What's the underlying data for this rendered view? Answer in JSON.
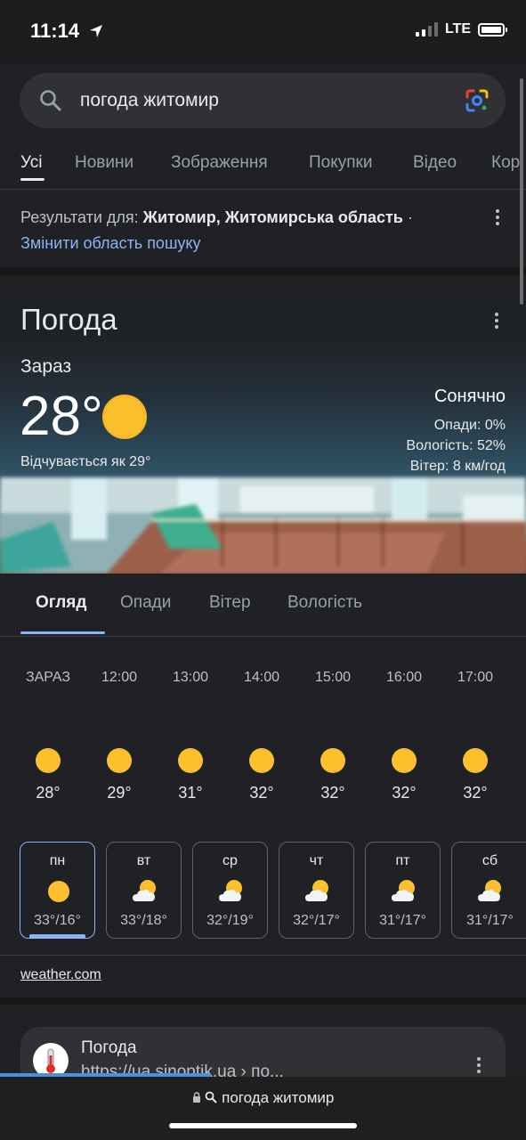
{
  "status": {
    "time": "11:14",
    "network": "LTE"
  },
  "search": {
    "query": "погода житомир"
  },
  "tabs": [
    "Усі",
    "Новини",
    "Зображення",
    "Покупки",
    "Відео",
    "Кор"
  ],
  "results_for": {
    "prefix": "Результати для: ",
    "location": "Житомир, Житомирська область",
    "suffix": " ·",
    "change_link": "Змінити область пошуку"
  },
  "weather": {
    "title": "Погода",
    "now_label": "Зараз",
    "temp": "28°",
    "feels_like": "Відчувається як 29°",
    "condition": "Сонячно",
    "precip": "Опади: 0%",
    "humidity": "Вологість: 52%",
    "wind": "Вітер: 8 км/год",
    "tabs": [
      "Огляд",
      "Опади",
      "Вітер",
      "Вологість"
    ],
    "hourly": [
      {
        "time": "ЗАРАЗ",
        "temp": "28°",
        "icon": "sun-icon"
      },
      {
        "time": "12:00",
        "temp": "29°",
        "icon": "sun-icon"
      },
      {
        "time": "13:00",
        "temp": "31°",
        "icon": "sun-icon"
      },
      {
        "time": "14:00",
        "temp": "32°",
        "icon": "sun-icon"
      },
      {
        "time": "15:00",
        "temp": "32°",
        "icon": "sun-icon"
      },
      {
        "time": "16:00",
        "temp": "32°",
        "icon": "sun-icon"
      },
      {
        "time": "17:00",
        "temp": "32°",
        "icon": "sun-icon"
      }
    ],
    "daily": [
      {
        "day": "пн",
        "temp": "33°/16°",
        "icon": "sun-icon"
      },
      {
        "day": "вт",
        "temp": "33°/18°",
        "icon": "partly-cloudy-icon"
      },
      {
        "day": "ср",
        "temp": "32°/19°",
        "icon": "partly-cloudy-icon"
      },
      {
        "day": "чт",
        "temp": "32°/17°",
        "icon": "partly-cloudy-icon"
      },
      {
        "day": "пт",
        "temp": "31°/17°",
        "icon": "partly-cloudy-icon"
      },
      {
        "day": "сб",
        "temp": "31°/17°",
        "icon": "partly-cloudy-icon"
      }
    ],
    "source": "weather.com"
  },
  "result": {
    "title": "Погода",
    "url": "https://ua.sinoptik.ua › по..."
  },
  "bottom": {
    "url": "погода житомир"
  },
  "colors": {
    "accent": "#8ab4f8",
    "sun": "#fbc02d",
    "background": "#202124"
  }
}
